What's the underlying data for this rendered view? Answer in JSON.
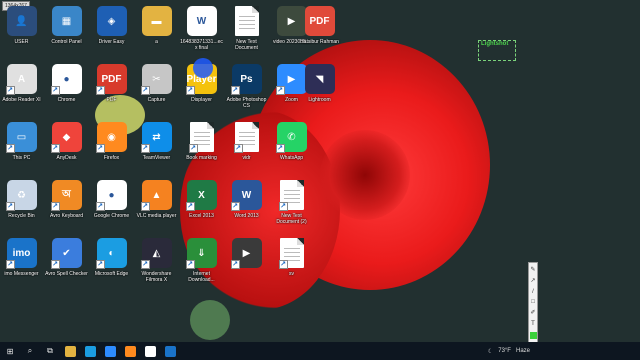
{
  "screen": {
    "resolution_badge": "1364x767"
  },
  "desktop": {
    "icons": [
      {
        "label": "USER",
        "glyph": "👤",
        "bg": "#2b4d7c",
        "icon": "user-folder-icon"
      },
      {
        "label": "Control Panel",
        "glyph": "▦",
        "bg": "#3a86c8",
        "icon": "control-panel-icon"
      },
      {
        "label": "Driver Easy",
        "glyph": "◈",
        "bg": "#1e5fb4",
        "icon": "driver-easy-icon"
      },
      {
        "label": "a",
        "glyph": "▬",
        "bg": "#e3b341",
        "icon": "folder-icon"
      },
      {
        "label": "164838371331...ecx final",
        "glyph": "W",
        "bg": "#ffffff",
        "icon": "word-doc-icon"
      },
      {
        "label": "New Text Document",
        "glyph": "",
        "bg": "#ffffff",
        "icon": "text-doc-icon"
      },
      {
        "label": "video 2023058...",
        "glyph": "▶",
        "bg": "#3d4a3d",
        "icon": "video-file-icon"
      },
      {
        "label": "Adobe Reader XI",
        "glyph": "A",
        "bg": "#e0e0e0",
        "icon": "adobe-reader-icon"
      },
      {
        "label": "Chrome",
        "glyph": "●",
        "bg": "#ffffff",
        "icon": "chrome-icon"
      },
      {
        "label": "PDF",
        "glyph": "PDF",
        "bg": "#d83a2c",
        "icon": "pdf-icon"
      },
      {
        "label": "Capture",
        "glyph": "✂",
        "bg": "#c6c6c6",
        "icon": "capture-icon"
      },
      {
        "label": "Displayer",
        "glyph": "Player",
        "bg": "#f4c20d",
        "icon": "player-icon"
      },
      {
        "label": "Adobe Photoshop CS",
        "glyph": "Ps",
        "bg": "#0b3a66",
        "icon": "photoshop-icon"
      },
      {
        "label": "Zoom",
        "glyph": "▶",
        "bg": "#2d8cff",
        "icon": "zoom-icon"
      },
      {
        "label": "This PC",
        "glyph": "▭",
        "bg": "#3a8fd8",
        "icon": "this-pc-icon"
      },
      {
        "label": "AnyDesk",
        "glyph": "◆",
        "bg": "#ef443b",
        "icon": "anydesk-icon"
      },
      {
        "label": "Firefox",
        "glyph": "◉",
        "bg": "#ff8a1f",
        "icon": "firefox-icon"
      },
      {
        "label": "TeamViewer",
        "glyph": "⇄",
        "bg": "#0e8ee9",
        "icon": "teamviewer-icon"
      },
      {
        "label": "Book marking",
        "glyph": "",
        "bg": "#ffffff",
        "icon": "bookmark-doc-icon"
      },
      {
        "label": "vidr",
        "glyph": "",
        "bg": "#ffffff",
        "icon": "text-doc-icon-2"
      },
      {
        "label": "WhatsApp",
        "glyph": "✆",
        "bg": "#25d366",
        "icon": "whatsapp-icon"
      },
      {
        "label": "Recycle Bin",
        "glyph": "♻",
        "bg": "#c8d6e6",
        "icon": "recycle-bin-icon"
      },
      {
        "label": "Avro Keyboard",
        "glyph": "অ",
        "bg": "#f08a24",
        "icon": "avro-keyboard-icon"
      },
      {
        "label": "Google Chrome",
        "glyph": "●",
        "bg": "#ffffff",
        "icon": "google-chrome-icon"
      },
      {
        "label": "VLC media player",
        "glyph": "▲",
        "bg": "#f58220",
        "icon": "vlc-icon"
      },
      {
        "label": "Excel 2013",
        "glyph": "X",
        "bg": "#1f7a45",
        "icon": "excel-icon"
      },
      {
        "label": "Word 2013",
        "glyph": "W",
        "bg": "#2b579a",
        "icon": "word-icon"
      },
      {
        "label": "New Text Document (2)",
        "glyph": "",
        "bg": "#ffffff",
        "icon": "text-doc-icon-3"
      },
      {
        "label": "imo Messenger",
        "glyph": "imo",
        "bg": "#1a73c9",
        "icon": "imo-icon"
      },
      {
        "label": "Avro Spell Checker",
        "glyph": "✔",
        "bg": "#3b7ddd",
        "icon": "spell-checker-icon"
      },
      {
        "label": "Microsoft Edge",
        "glyph": "◐",
        "bg": "#1b9de2",
        "icon": "edge-icon"
      },
      {
        "label": "Wondershare Filmora X",
        "glyph": "◭",
        "bg": "#2a2a3a",
        "icon": "filmora-icon"
      },
      {
        "label": "Internet Download...",
        "glyph": "⇓",
        "bg": "#2a8f3a",
        "icon": "idm-icon"
      },
      {
        "label": "",
        "glyph": "▶",
        "bg": "#3a3a3a",
        "icon": "video-thumb-icon"
      },
      {
        "label": "sv",
        "glyph": "",
        "bg": "#ffffff",
        "icon": "text-doc-icon-4"
      }
    ],
    "top_right_icon": {
      "label": "Hatsibur Rahman",
      "glyph": "PDF",
      "bg": "#e04a3a"
    },
    "extra_icon": {
      "label": "Lightroom",
      "glyph": "◥",
      "bg": "#2e2e56"
    }
  },
  "lightshot": {
    "label": "Lightshot"
  },
  "lightshot_tools_vertical": [
    "✎",
    "↗",
    "/",
    "□",
    "✐",
    "T",
    ""
  ],
  "lightshot_tools_horizontal": [
    "⇲",
    "⬆",
    "✉",
    "⎘",
    "🖶",
    "▢",
    "✕",
    "⬇",
    "✂",
    "✓"
  ],
  "taskbar": {
    "start": "⊞",
    "search": "⌕",
    "task_view": "⧉",
    "apps": [
      "#e3b341",
      "#1b9de2",
      "#2d8cff",
      "#ff8a1f",
      "#ffffff",
      "#1a73c9"
    ],
    "tray": {
      "moon": "☾",
      "temperature": "73°F",
      "lang": "Haze"
    }
  }
}
